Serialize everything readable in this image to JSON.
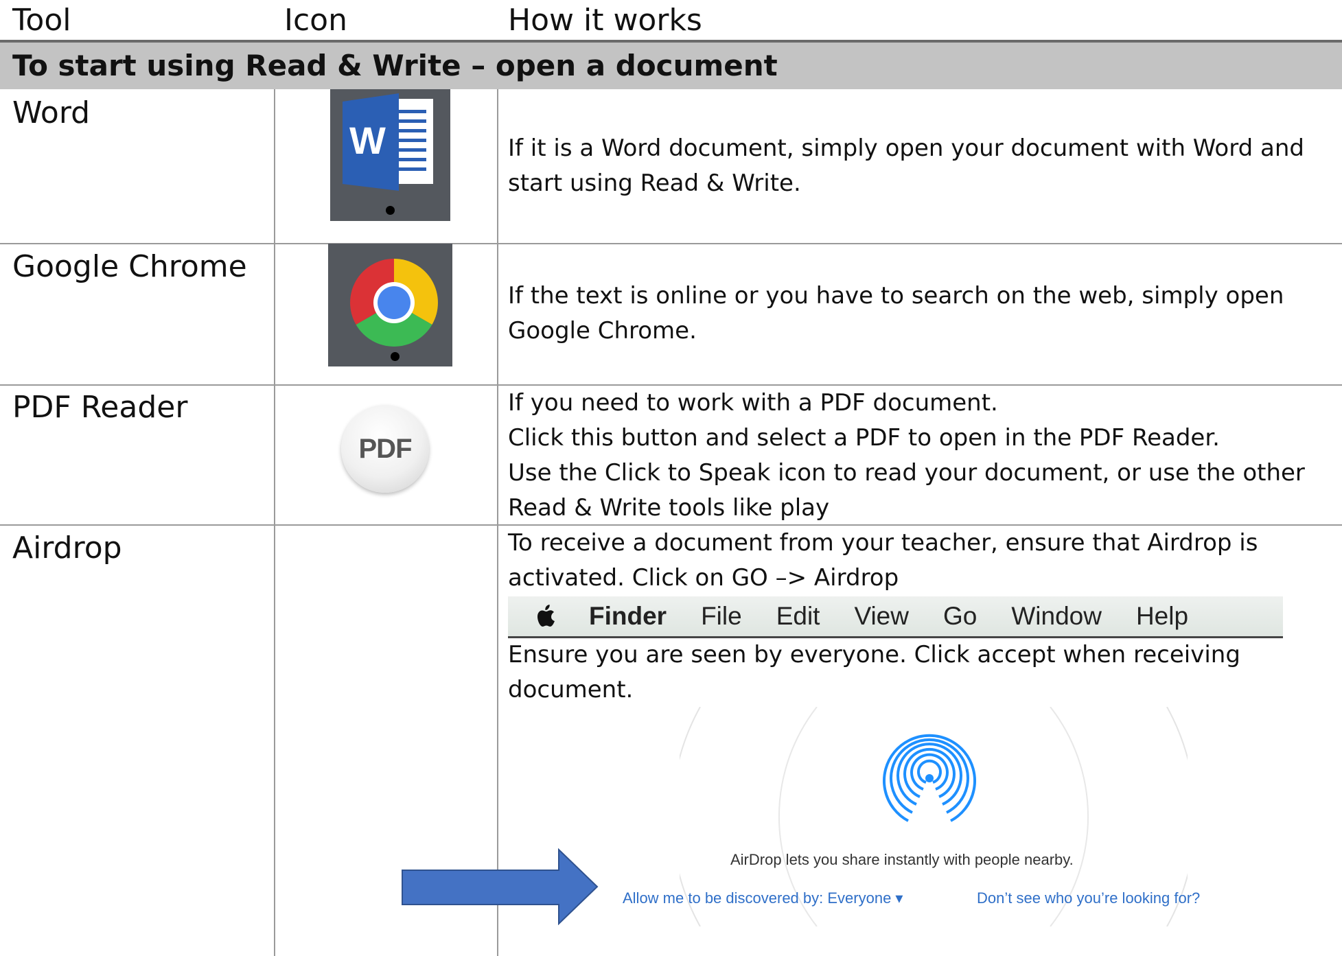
{
  "header": {
    "tool": "Tool",
    "icon": "Icon",
    "how": "How it works"
  },
  "section": {
    "title": "To start using Read & Write – open a document"
  },
  "rows": [
    {
      "tool": "Word",
      "icon": "word-icon",
      "desc": [
        "If it is a Word document, simply open your document with Word and",
        "start using Read & Write."
      ],
      "icon_label": "W"
    },
    {
      "tool": "Google Chrome",
      "icon": "chrome-icon",
      "desc": [
        "If the text is online or you have to search on the web, simply open",
        "Google Chrome."
      ]
    },
    {
      "tool": "PDF Reader",
      "icon": "pdf-icon",
      "icon_label": "PDF",
      "desc": [
        "If you need to work with a PDF document.",
        "Click this button and select a PDF to open in the PDF Reader.",
        "Use the Click to Speak icon to read your document, or use the other",
        "Read & Write tools like play"
      ]
    },
    {
      "tool": "Airdrop",
      "desc": [
        "To receive a document from your teacher, ensure that Airdrop is",
        "activated. Click on GO –> Airdrop"
      ],
      "desc2": [
        "Ensure you are seen by everyone. Click accept when receiving",
        "document."
      ]
    }
  ],
  "menubar": {
    "items": [
      "Finder",
      "File",
      "Edit",
      "View",
      "Go",
      "Window",
      "Help"
    ]
  },
  "airdrop_panel": {
    "note": "AirDrop lets you share instantly with people nearby.",
    "discover_link": "Allow me to be discovered by: Everyone ▾",
    "help_link": "Don’t see who you’re looking for?"
  },
  "colors": {
    "band": "#c3c3c3",
    "word_blue": "#2b5fb4",
    "arrow": "#4472c4",
    "link": "#2f6fc8",
    "airdrop_icon": "#1e90ff"
  }
}
